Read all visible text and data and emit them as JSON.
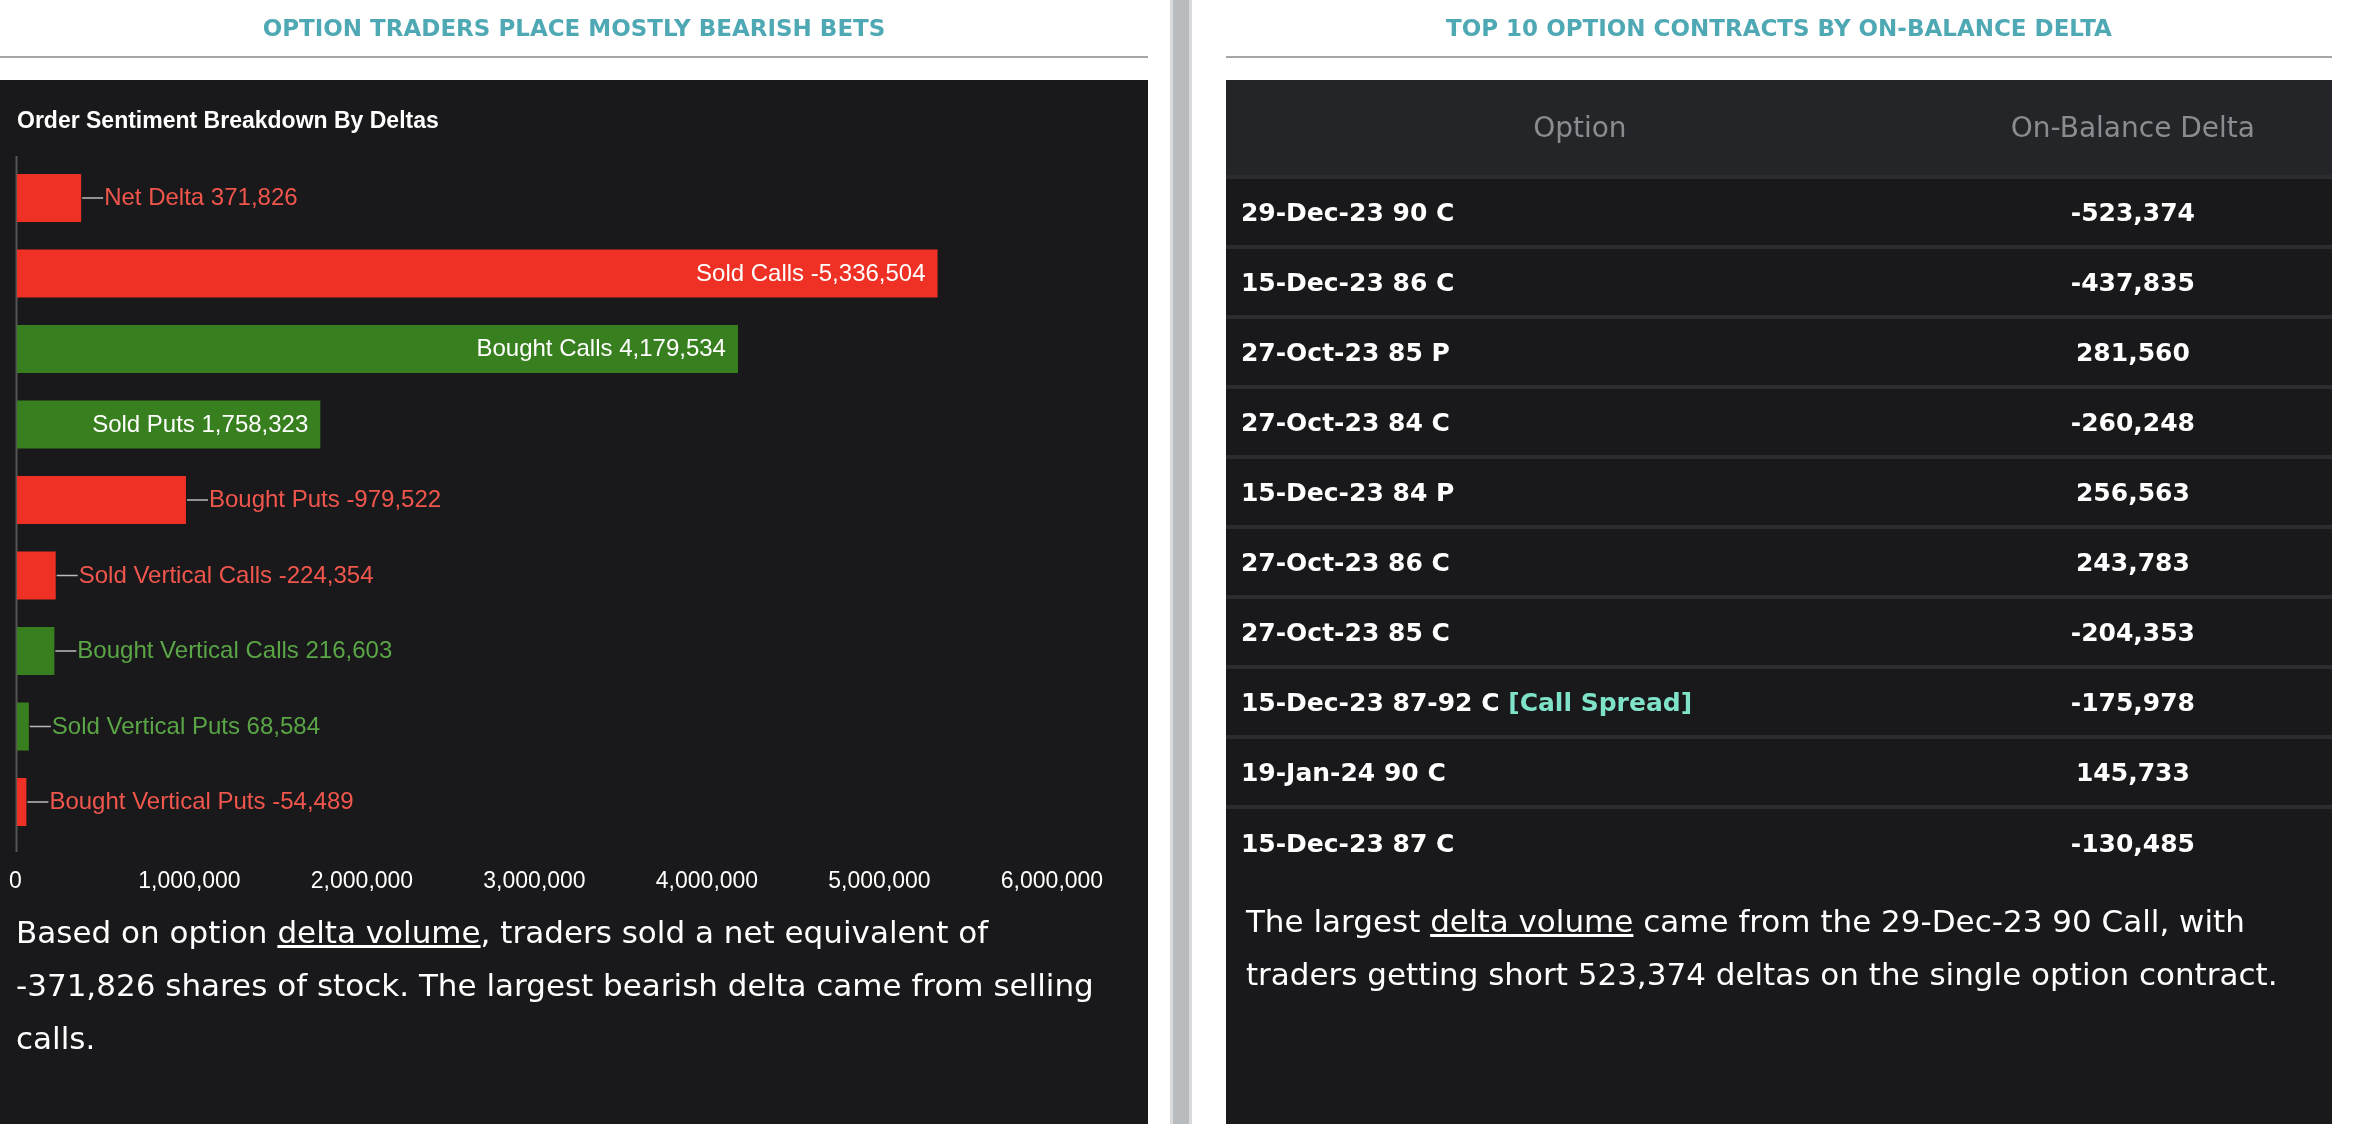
{
  "left_panel": {
    "heading": "OPTION TRADERS PLACE MOSTLY BEARISH BETS",
    "chart_data": {
      "type": "bar",
      "orientation": "horizontal",
      "title": "Order Sentiment Breakdown By Deltas",
      "categories": [
        "Net Delta",
        "Sold Calls",
        "Bought Calls",
        "Sold Puts",
        "Bought Puts",
        "Sold Vertical Calls",
        "Bought Vertical Calls",
        "Sold Vertical Puts",
        "Bought Vertical Puts"
      ],
      "series": [
        {
          "color": "#ee3124",
          "values": [
            371826,
            5336504,
            null,
            null,
            979522,
            224354,
            null,
            null,
            54489
          ]
        },
        {
          "color": "#38801f",
          "values": [
            null,
            null,
            4179534,
            1758323,
            null,
            null,
            216603,
            68584,
            null
          ]
        }
      ],
      "value_labels": [
        "371,826",
        "-5,336,504",
        "4,179,534",
        "1,758,323",
        "-979,522",
        "-224,354",
        "216,603",
        "68,584",
        "-54,489"
      ],
      "xlim": [
        0,
        6000000
      ],
      "xticks": [
        {
          "value": 0,
          "label": "0"
        },
        {
          "value": 1000000,
          "label": "1,000,000"
        },
        {
          "value": 2000000,
          "label": "2,000,000"
        },
        {
          "value": 3000000,
          "label": "3,000,000"
        },
        {
          "value": 4000000,
          "label": "4,000,000"
        },
        {
          "value": 5000000,
          "label": "5,000,000"
        },
        {
          "value": 6000000,
          "label": "6,000,000"
        }
      ]
    },
    "summary": {
      "before": "Based on option ",
      "link": "delta volume",
      "after": ", traders sold a net equivalent of -371,826 shares of stock. The largest bearish delta came from selling calls."
    }
  },
  "right_panel": {
    "heading": "TOP 10 OPTION CONTRACTS BY ON-BALANCE DELTA",
    "table": {
      "columns": [
        "Option",
        "On-Balance Delta"
      ],
      "rows": [
        {
          "option": "29-Dec-23 90 C",
          "delta": "-523,374"
        },
        {
          "option": "15-Dec-23 86 C",
          "delta": "-437,835"
        },
        {
          "option": "27-Oct-23 85 P",
          "delta": "281,560"
        },
        {
          "option": "27-Oct-23 84 C",
          "delta": "-260,248"
        },
        {
          "option": "15-Dec-23 84 P",
          "delta": "256,563"
        },
        {
          "option": "27-Oct-23 86 C",
          "delta": "243,783"
        },
        {
          "option": "27-Oct-23 85 C",
          "delta": "-204,353"
        },
        {
          "option": "15-Dec-23 87-92 C",
          "tag": "[Call Spread]",
          "delta": "-175,978"
        },
        {
          "option": "19-Jan-24 90 C",
          "delta": "145,733"
        },
        {
          "option": "15-Dec-23 87 C",
          "delta": "-130,485"
        }
      ]
    },
    "summary": {
      "before": "The largest ",
      "link": "delta volume",
      "after": " came from the 29-Dec-23 90 Call, with traders getting short 523,374 deltas on the single option contract."
    }
  }
}
